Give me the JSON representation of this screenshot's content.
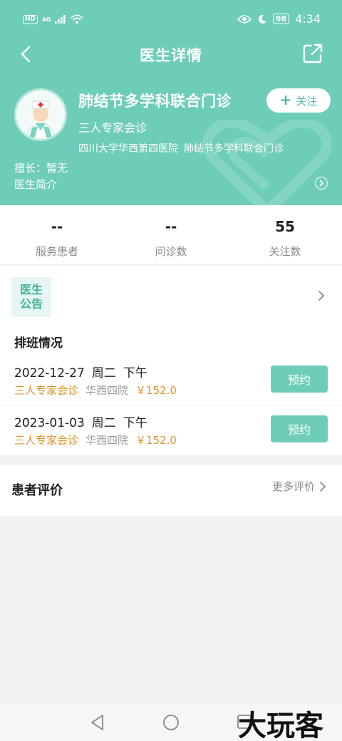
{
  "status_bar": {
    "network_badge": "HD",
    "network_type": "4G",
    "battery": "98",
    "time": "4:34"
  },
  "nav": {
    "title": "医生详情"
  },
  "doctor": {
    "name": "肺结节多学科联合门诊",
    "follow_label": "关注",
    "consult_type": "三人专家会诊",
    "hospital": "四川大学华西第四医院",
    "department": "肺结节多学科联合门诊",
    "specialty": "擅长：暂无",
    "intro_label": "医生简介"
  },
  "stats": [
    {
      "value": "--",
      "label": "服务患者"
    },
    {
      "value": "--",
      "label": "问诊数"
    },
    {
      "value": "55",
      "label": "关注数"
    }
  ],
  "notice": {
    "badge_line1": "医生",
    "badge_line2": "公告"
  },
  "schedule": {
    "title": "排班情况",
    "rows": [
      {
        "date": "2022-12-27",
        "weekday": "周二",
        "period": "下午",
        "type": "三人专家会诊",
        "hospital": "华西四院",
        "price": "￥152.0",
        "action": "预约"
      },
      {
        "date": "2023-01-03",
        "weekday": "周二",
        "period": "下午",
        "type": "三人专家会诊",
        "hospital": "华西四院",
        "price": "￥152.0",
        "action": "预约"
      }
    ]
  },
  "reviews": {
    "title": "患者评价",
    "more_label": "更多评价"
  },
  "watermark_text": "大玩客",
  "colors": {
    "brand": "#6ecdb8",
    "accent_text": "#e0932b",
    "muted": "#8a8a8a"
  }
}
